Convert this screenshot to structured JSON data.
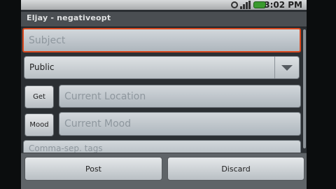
{
  "status_bar": {
    "time": "3:02 PM",
    "icons": [
      "sync-icon",
      "signal-icon",
      "battery-icon"
    ]
  },
  "window": {
    "title": "Eljay - negativeopt"
  },
  "form": {
    "subject_placeholder": "Subject",
    "security_value": "Public",
    "location": {
      "button_label": "Get",
      "placeholder": "Current Location"
    },
    "mood": {
      "button_label": "Mood",
      "placeholder": "Current Mood"
    },
    "tags_placeholder": "Comma-sep. tags"
  },
  "actions": {
    "post_label": "Post",
    "discard_label": "Discard"
  },
  "colors": {
    "focus_border": "#d9491f",
    "field_bg": "#c4cbd0",
    "battery": "#3a9a2e"
  }
}
